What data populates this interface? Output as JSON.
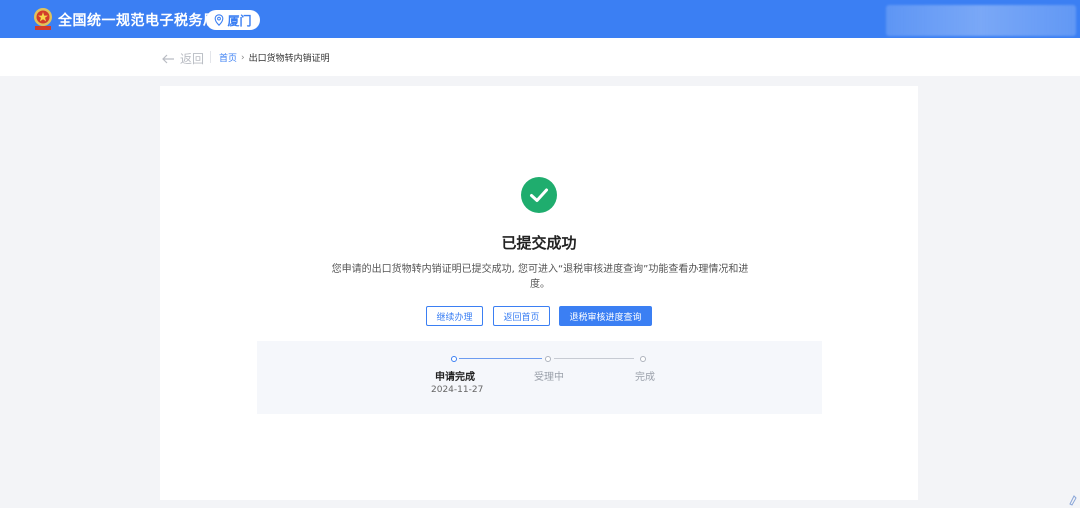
{
  "header": {
    "site_title": "全国统一规范电子税务局",
    "region": "厦门",
    "brand_color": "#3b7ff3",
    "emblem_icon": "tax-emblem-icon",
    "region_icon": "location-pin-icon"
  },
  "breadcrumb": {
    "back_label": "返回",
    "back_icon": "arrow-left-icon",
    "home": "首页",
    "separator": "›",
    "current": "出口货物转内销证明"
  },
  "result": {
    "status_icon": "check-circle-icon",
    "status_color": "#1fad6e",
    "title": "已提交成功",
    "description": "您申请的出口货物转内销证明已提交成功, 您可进入“退税审核进度查询”功能查看办理情况和进度。"
  },
  "actions": {
    "continue": "继续办理",
    "home": "返回首页",
    "query": "退税审核进度查询"
  },
  "progress": {
    "steps": [
      {
        "label": "申请完成",
        "date": "2024-11-27",
        "state": "done"
      },
      {
        "label": "受理中",
        "state": "pending"
      },
      {
        "label": "完成",
        "state": "pending"
      }
    ]
  }
}
